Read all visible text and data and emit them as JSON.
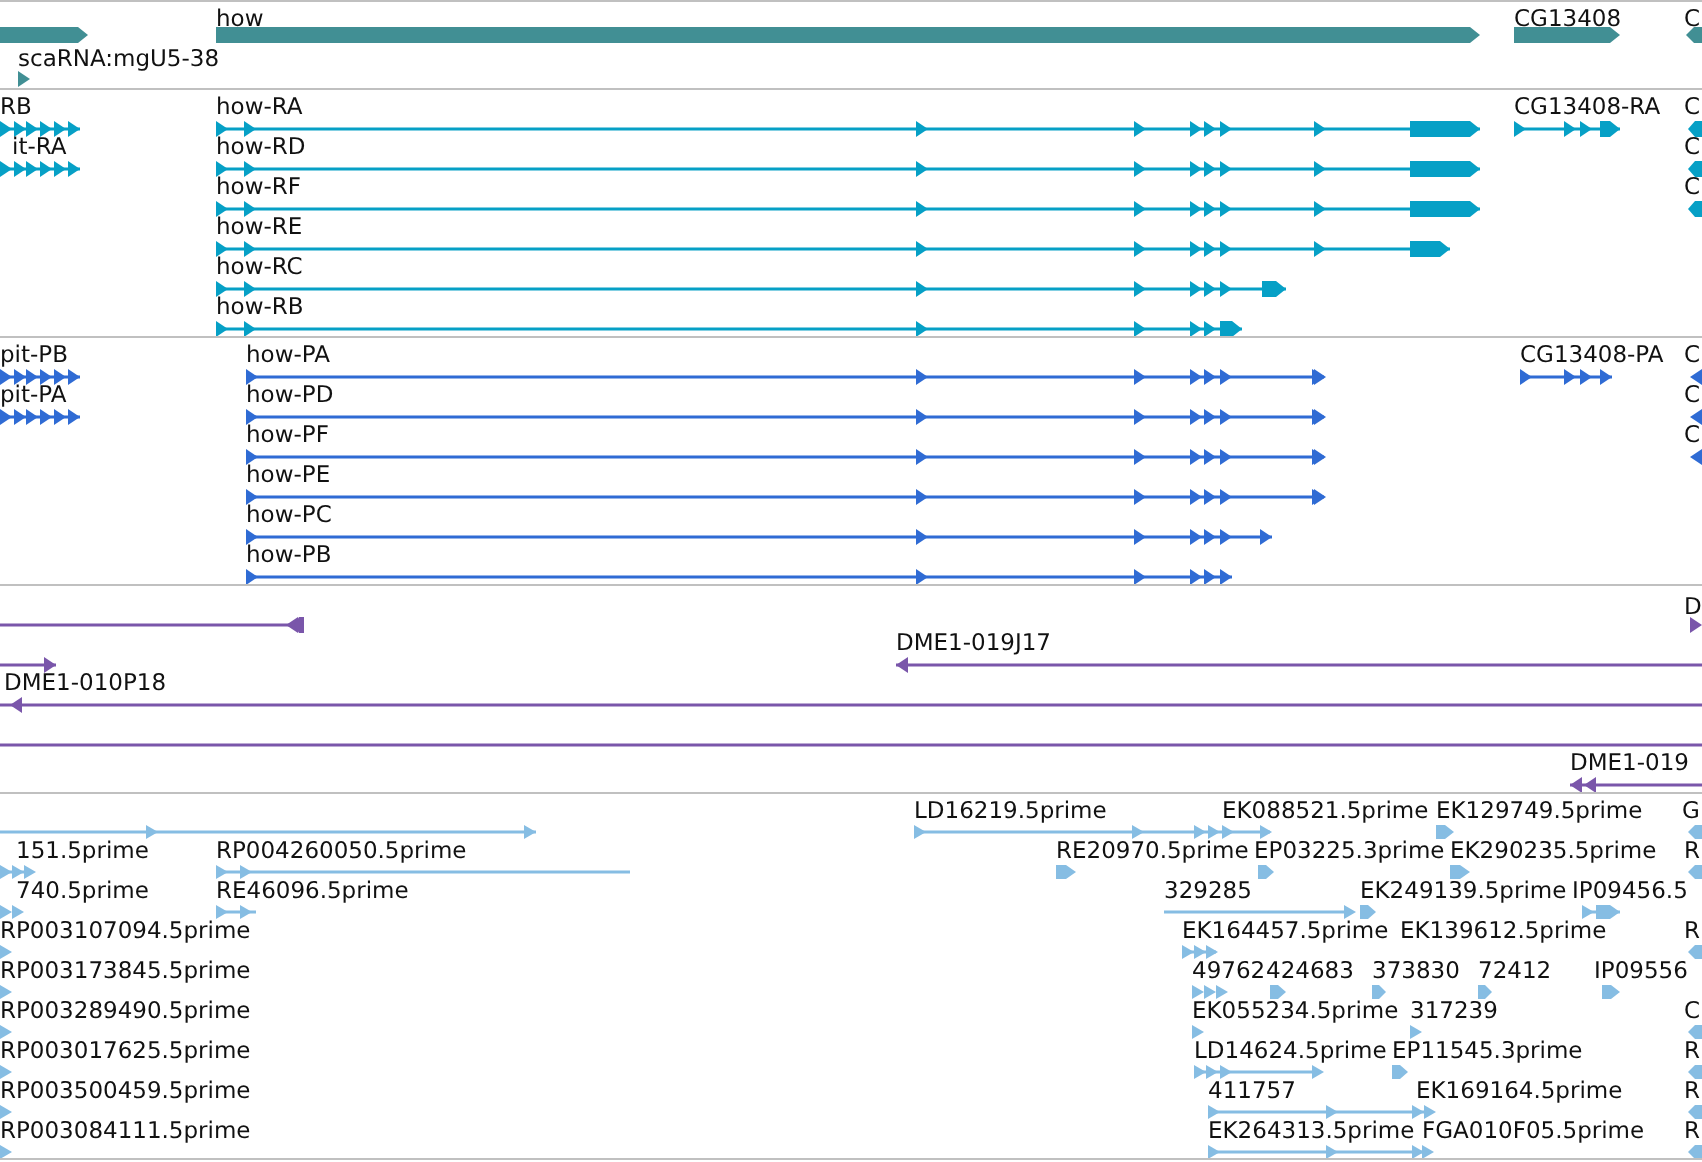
{
  "tracks": [
    {
      "kind": "gene",
      "features": [
        {
          "kind": "unlabeled"
        },
        {
          "kind": "labeled",
          "label": "scaRNA:mgU5-38"
        },
        {
          "kind": "labeled",
          "label": "how"
        },
        {
          "kind": "labeled",
          "label": "CG13408"
        },
        {
          "kind": "labeled",
          "label": "C"
        }
      ]
    },
    {
      "kind": "transcript",
      "features": [
        {
          "kind": "labeled",
          "label": "RB"
        },
        {
          "kind": "labeled",
          "label": "it-RA"
        },
        {
          "kind": "labeled",
          "label": "how-RA"
        },
        {
          "kind": "labeled",
          "label": "how-RD"
        },
        {
          "kind": "labeled",
          "label": "how-RF"
        },
        {
          "kind": "labeled",
          "label": "how-RE"
        },
        {
          "kind": "labeled",
          "label": "how-RC"
        },
        {
          "kind": "labeled",
          "label": "how-RB"
        },
        {
          "kind": "labeled",
          "label": "CG13408-RA"
        },
        {
          "kind": "labeled",
          "label": "C"
        },
        {
          "kind": "labeled",
          "label": "C"
        },
        {
          "kind": "labeled",
          "label": "C"
        }
      ]
    },
    {
      "kind": "protein",
      "features": [
        {
          "kind": "labeled",
          "label": "pit-PB"
        },
        {
          "kind": "labeled",
          "label": "pit-PA"
        },
        {
          "kind": "labeled",
          "label": "how-PA"
        },
        {
          "kind": "labeled",
          "label": "how-PD"
        },
        {
          "kind": "labeled",
          "label": "how-PF"
        },
        {
          "kind": "labeled",
          "label": "how-PE"
        },
        {
          "kind": "labeled",
          "label": "how-PC"
        },
        {
          "kind": "labeled",
          "label": "how-PB"
        },
        {
          "kind": "labeled",
          "label": "CG13408-PA"
        },
        {
          "kind": "labeled",
          "label": "C"
        },
        {
          "kind": "labeled",
          "label": "C"
        },
        {
          "kind": "labeled",
          "label": "C"
        }
      ]
    },
    {
      "kind": "clone",
      "features": [
        {
          "kind": "unlabeled"
        },
        {
          "kind": "unlabeled"
        },
        {
          "kind": "labeled",
          "label": "DME1-010P18"
        },
        {
          "kind": "unlabeled"
        },
        {
          "kind": "labeled",
          "label": "DME1-019J17"
        },
        {
          "kind": "labeled",
          "label": "D"
        },
        {
          "kind": "labeled",
          "label": "DME1-019"
        }
      ]
    },
    {
      "kind": "est",
      "features": [
        {
          "kind": "unlabeled"
        },
        {
          "kind": "labeled",
          "label": "LD16219.5prime"
        },
        {
          "kind": "labeled",
          "label": "EK088521.5prime"
        },
        {
          "kind": "labeled",
          "label": "EK129749.5prime"
        },
        {
          "kind": "labeled",
          "label": "G"
        },
        {
          "kind": "labeled",
          "label": "151.5prime"
        },
        {
          "kind": "labeled",
          "label": "RP004260050.5prime"
        },
        {
          "kind": "labeled",
          "label": "RE20970.5prime"
        },
        {
          "kind": "labeled",
          "label": "EP03225.3prime"
        },
        {
          "kind": "labeled",
          "label": "EK290235.5prime"
        },
        {
          "kind": "labeled",
          "label": "R"
        },
        {
          "kind": "labeled",
          "label": "740.5prime"
        },
        {
          "kind": "labeled",
          "label": "RE46096.5prime"
        },
        {
          "kind": "labeled",
          "label": "329285"
        },
        {
          "kind": "labeled",
          "label": "EK249139.5prime"
        },
        {
          "kind": "labeled",
          "label": "IP09456.5"
        },
        {
          "kind": "labeled",
          "label": "RP003107094.5prime"
        },
        {
          "kind": "labeled",
          "label": "EK164457.5prime"
        },
        {
          "kind": "labeled",
          "label": "EK139612.5prime"
        },
        {
          "kind": "labeled",
          "label": "R"
        },
        {
          "kind": "labeled",
          "label": "RP003173845.5prime"
        },
        {
          "kind": "labeled",
          "label": "49762"
        },
        {
          "kind": "labeled",
          "label": "424683"
        },
        {
          "kind": "labeled",
          "label": "373830"
        },
        {
          "kind": "labeled",
          "label": "72412"
        },
        {
          "kind": "labeled",
          "label": "IP09556"
        },
        {
          "kind": "labeled",
          "label": "RP003289490.5prime"
        },
        {
          "kind": "labeled",
          "label": "EK055234.5prime"
        },
        {
          "kind": "labeled",
          "label": "317239"
        },
        {
          "kind": "labeled",
          "label": "C"
        },
        {
          "kind": "labeled",
          "label": "RP003017625.5prime"
        },
        {
          "kind": "labeled",
          "label": "LD14624.5prime"
        },
        {
          "kind": "labeled",
          "label": "EP11545.3prime"
        },
        {
          "kind": "labeled",
          "label": "R"
        },
        {
          "kind": "labeled",
          "label": "RP003500459.5prime"
        },
        {
          "kind": "labeled",
          "label": "411757"
        },
        {
          "kind": "labeled",
          "label": "EK169164.5prime"
        },
        {
          "kind": "labeled",
          "label": "R"
        },
        {
          "kind": "labeled",
          "label": "RP003084111.5prime"
        },
        {
          "kind": "labeled",
          "label": "EK264313.5prime"
        },
        {
          "kind": "labeled",
          "label": "FGA010F05.5prime"
        },
        {
          "kind": "labeled",
          "label": "R"
        }
      ]
    }
  ]
}
